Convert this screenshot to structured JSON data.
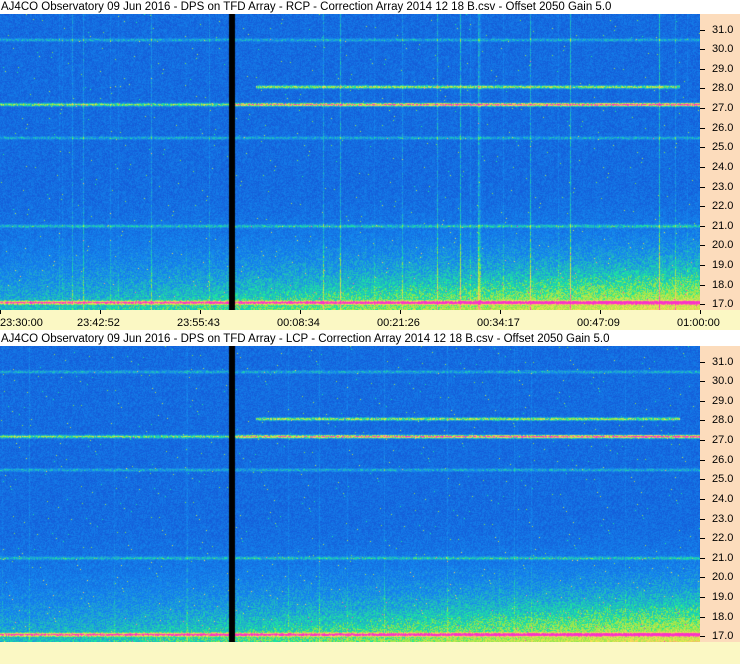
{
  "panels": [
    {
      "title": "AJ4CO Observatory 09 Jun 2016  -  DPS on TFD Array  -  RCP  -  Correction Array 2014 12 18 B.csv  -  Offset 2050  Gain 5.0"
    },
    {
      "title": "AJ4CO Observatory 09 Jun 2016  -  DPS on TFD Array  -  LCP  -  Correction Array 2014 12 18 B.csv  -  Offset 2050  Gain 5.0"
    }
  ],
  "chart_data": [
    {
      "type": "heatmap",
      "polarization": "RCP",
      "x_ticks": [
        "23:30:00",
        "23:42:52",
        "23:55:43",
        "00:08:34",
        "00:21:26",
        "00:34:17",
        "00:47:09",
        "01:00:00"
      ],
      "y_ticks": [
        "17.0",
        "18.0",
        "19.0",
        "20.0",
        "21.0",
        "22.0",
        "23.0",
        "24.0",
        "25.0",
        "26.0",
        "27.0",
        "28.0",
        "29.0",
        "30.0",
        "31.0"
      ],
      "ylim": [
        16.7,
        31.8
      ],
      "data_gap_time": "23:58",
      "bands_mhz": [
        17.1,
        21.0,
        25.5,
        27.2,
        28.1,
        30.5
      ],
      "colors": {
        "background": "#1f4fd6",
        "band": "#e8e830",
        "hot": "#ff2080"
      }
    },
    {
      "type": "heatmap",
      "polarization": "LCP",
      "x_ticks": [],
      "y_ticks": [
        "17.0",
        "18.0",
        "19.0",
        "20.0",
        "21.0",
        "22.0",
        "23.0",
        "24.0",
        "25.0",
        "26.0",
        "27.0",
        "28.0",
        "29.0",
        "30.0",
        "31.0"
      ],
      "ylim": [
        16.7,
        31.8
      ],
      "data_gap_time": "23:58",
      "bands_mhz": [
        17.1,
        21.0,
        25.5,
        27.2,
        28.1,
        30.5
      ],
      "colors": {
        "background": "#1f4fd6",
        "band": "#e8e830",
        "hot": "#ff2080"
      }
    }
  ]
}
